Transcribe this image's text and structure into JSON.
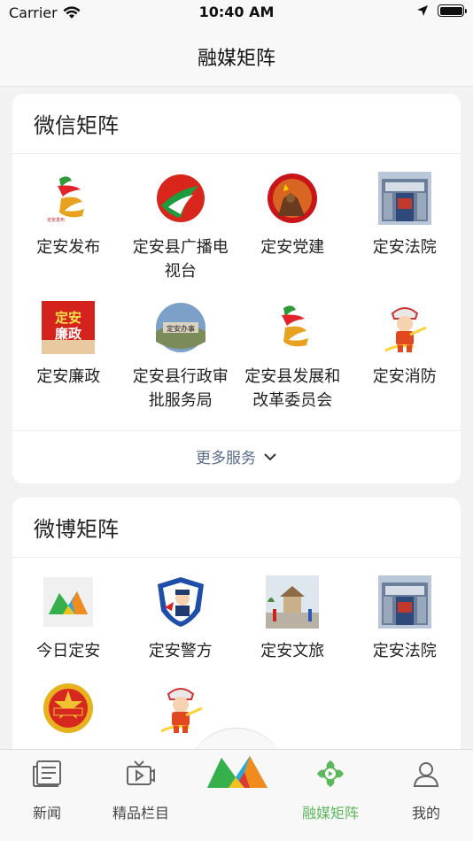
{
  "status_bar": {
    "carrier": "Carrier",
    "time": "10:40 AM"
  },
  "nav": {
    "title": "融媒矩阵"
  },
  "wechat_section": {
    "title": "微信矩阵",
    "items": [
      {
        "label": "定安发布",
        "icon": "dingan-logo-icon"
      },
      {
        "label": "定安县广播电视台",
        "icon": "tv-station-logo-icon"
      },
      {
        "label": "定安党建",
        "icon": "party-emblem-icon"
      },
      {
        "label": "定安法院",
        "icon": "court-building-icon"
      },
      {
        "label": "定安廉政",
        "icon": "clean-govt-icon"
      },
      {
        "label": "定安县行政审批服务局",
        "icon": "admin-service-icon"
      },
      {
        "label": "定安县发展和改革委员会",
        "icon": "dingan-logo-icon"
      },
      {
        "label": "定安消防",
        "icon": "firefighter-icon"
      }
    ],
    "more_label": "更多服务"
  },
  "weibo_section": {
    "title": "微博矩阵",
    "items": [
      {
        "label": "今日定安",
        "icon": "today-dingan-logo-icon"
      },
      {
        "label": "定安警方",
        "icon": "police-badge-icon"
      },
      {
        "label": "定安文旅",
        "icon": "culture-tourism-icon"
      },
      {
        "label": "定安法院",
        "icon": "court-building-icon"
      },
      {
        "label": "",
        "icon": "youth-league-badge-icon"
      },
      {
        "label": "",
        "icon": "firefighter-icon"
      }
    ]
  },
  "tab_bar": {
    "tabs": [
      {
        "label": "新闻",
        "icon": "newspaper-icon"
      },
      {
        "label": "精品栏目",
        "icon": "video-icon"
      },
      {
        "label": "",
        "icon": "center-logo-icon"
      },
      {
        "label": "融媒矩阵",
        "icon": "matrix-icon",
        "active": true
      },
      {
        "label": "我的",
        "icon": "user-icon"
      }
    ]
  },
  "colors": {
    "active_tab": "#5cb85c",
    "more_link": "#5a6a8a"
  }
}
